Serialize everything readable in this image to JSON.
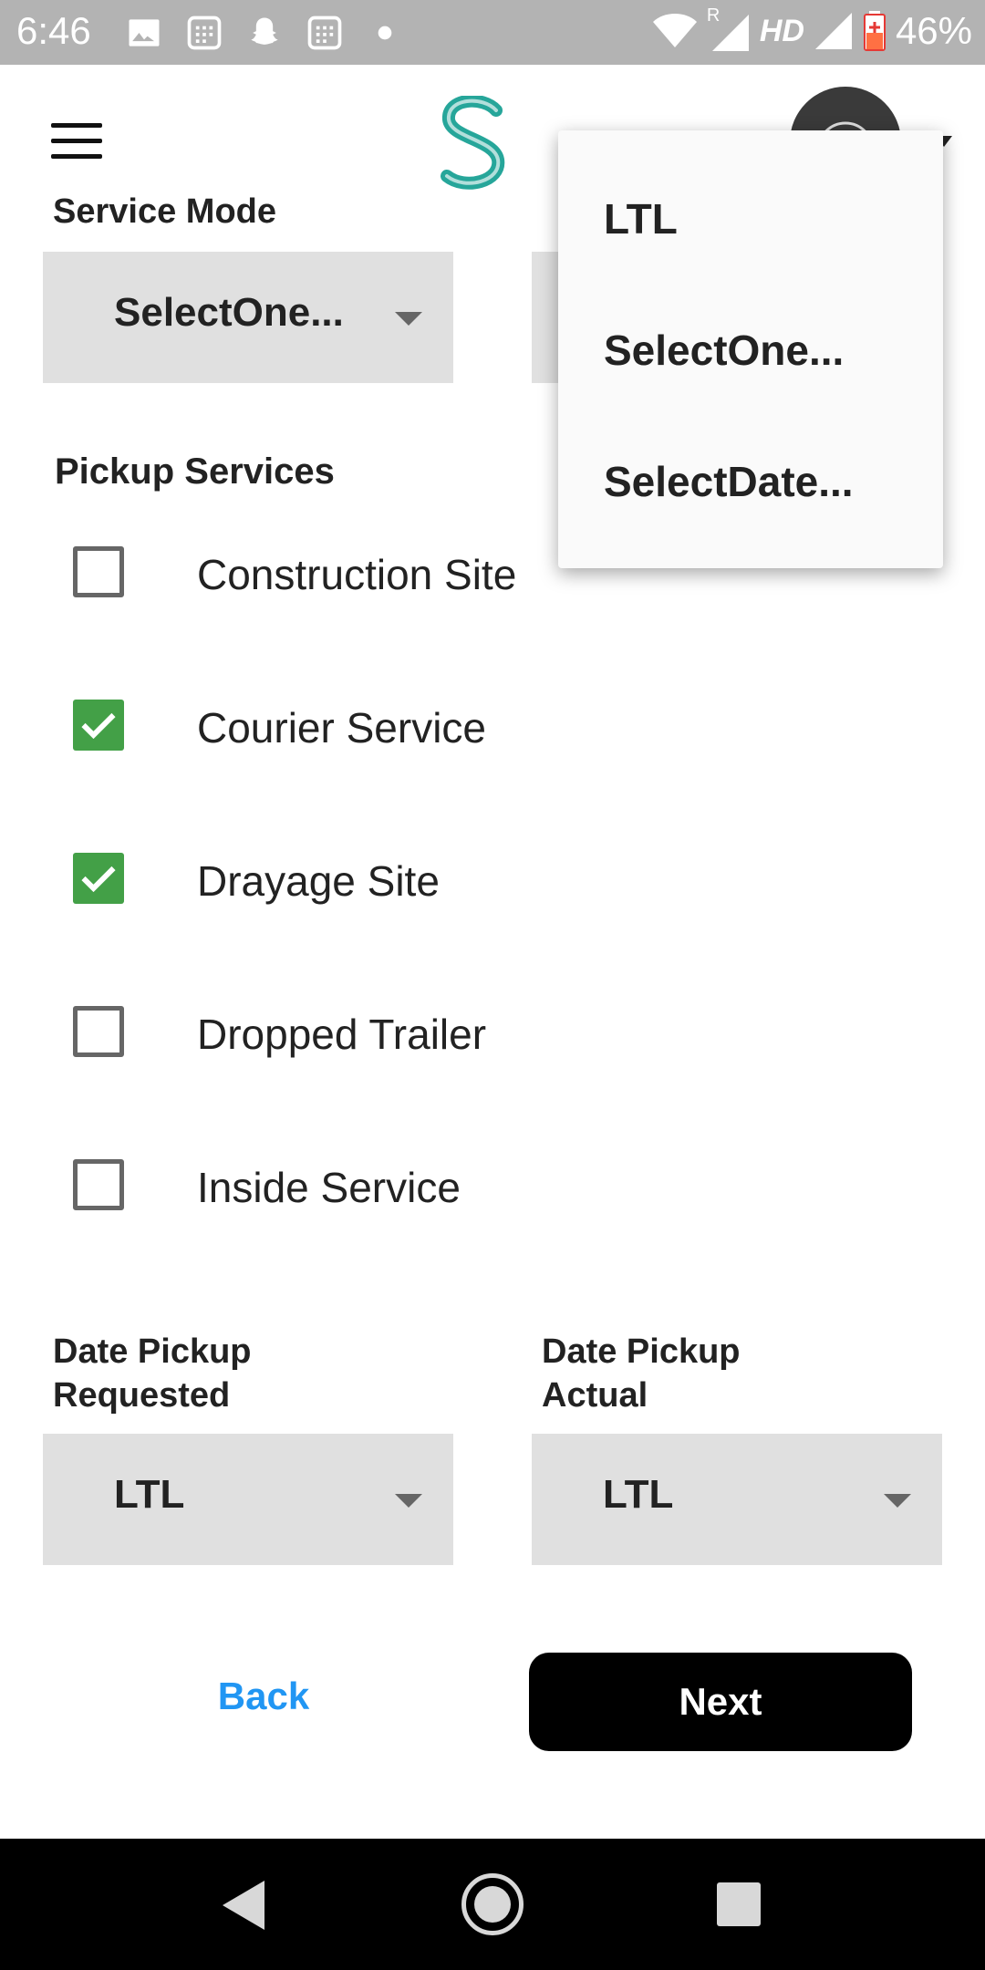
{
  "status_bar": {
    "time": "6:46",
    "network": "HD",
    "roaming": "R",
    "battery": "46%",
    "icons": [
      "image-icon",
      "calendar-icon",
      "snapchat-icon",
      "calendar-icon",
      "dot-icon",
      "wifi-icon",
      "signal-icon",
      "signal-icon",
      "battery-charging-icon"
    ]
  },
  "app_bar": {
    "menu_icon": "hamburger-icon",
    "logo_letter": "S"
  },
  "form": {
    "service_mode_label": "Service Mode",
    "service_mode_value": "SelectOne...",
    "pickup_services_title": "Pickup Services",
    "pickup_services": [
      {
        "label": "Construction Site",
        "checked": false
      },
      {
        "label": "Courier Service",
        "checked": true
      },
      {
        "label": "Drayage Site",
        "checked": true
      },
      {
        "label": "Dropped Trailer",
        "checked": false
      },
      {
        "label": "Inside Service",
        "checked": false
      }
    ],
    "date_requested_label_line1": "Date Pickup",
    "date_requested_label_line2": "Requested",
    "date_requested_value": "LTL",
    "date_actual_label_line1": "Date Pickup",
    "date_actual_label_line2": "Actual",
    "date_actual_value": "LTL"
  },
  "buttons": {
    "back": "Back",
    "next": "Next"
  },
  "popup_menu": {
    "items": [
      "LTL",
      "SelectOne...",
      "SelectDate..."
    ]
  },
  "colors": {
    "accent_blue": "#2196f3",
    "check_green": "#43a047",
    "dropdown_bg": "#e0e0e0",
    "status_bar": "#b3b3b3"
  }
}
